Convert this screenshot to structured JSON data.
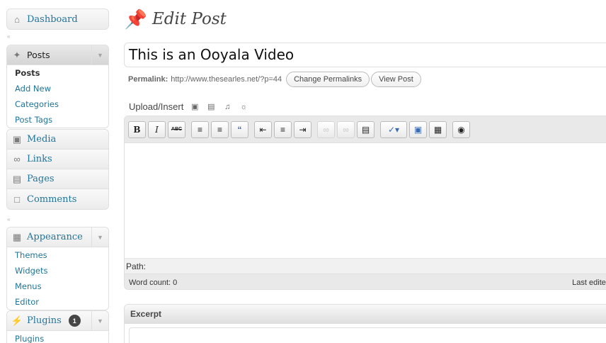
{
  "sidebar": {
    "dashboard": {
      "label": "Dashboard",
      "icon": "dashboard-icon"
    },
    "posts": {
      "label": "Posts",
      "icon": "pushpin-icon",
      "items": [
        {
          "label": "Posts"
        },
        {
          "label": "Add New"
        },
        {
          "label": "Categories"
        },
        {
          "label": "Post Tags"
        }
      ]
    },
    "media": {
      "label": "Media",
      "icon": "media-icon"
    },
    "links": {
      "label": "Links",
      "icon": "link-icon"
    },
    "pages": {
      "label": "Pages",
      "icon": "pages-icon"
    },
    "comments": {
      "label": "Comments",
      "icon": "comment-icon"
    },
    "appearance": {
      "label": "Appearance",
      "icon": "appearance-icon",
      "items": [
        {
          "label": "Themes"
        },
        {
          "label": "Widgets"
        },
        {
          "label": "Menus"
        },
        {
          "label": "Editor"
        }
      ]
    },
    "plugins": {
      "label": "Plugins",
      "icon": "plug-icon",
      "badge": "1",
      "items": [
        {
          "label": "Plugins"
        }
      ]
    },
    "separator": "«"
  },
  "main": {
    "page_title": "Edit Post",
    "post_title": "This is an Ooyala Video",
    "permalink": {
      "label": "Permalink:",
      "url": "http://www.thesearles.net/?p=44",
      "change_button": "Change Permalinks",
      "view_button": "View Post"
    },
    "upload": {
      "label": "Upload/Insert"
    },
    "editor": {
      "path_label": "Path:",
      "word_count": "Word count: 0",
      "last_edited": "Last edited"
    },
    "excerpt": {
      "title": "Excerpt"
    }
  },
  "colors": {
    "link": "#21759b",
    "text": "#333333",
    "border": "#dfdfdf"
  }
}
